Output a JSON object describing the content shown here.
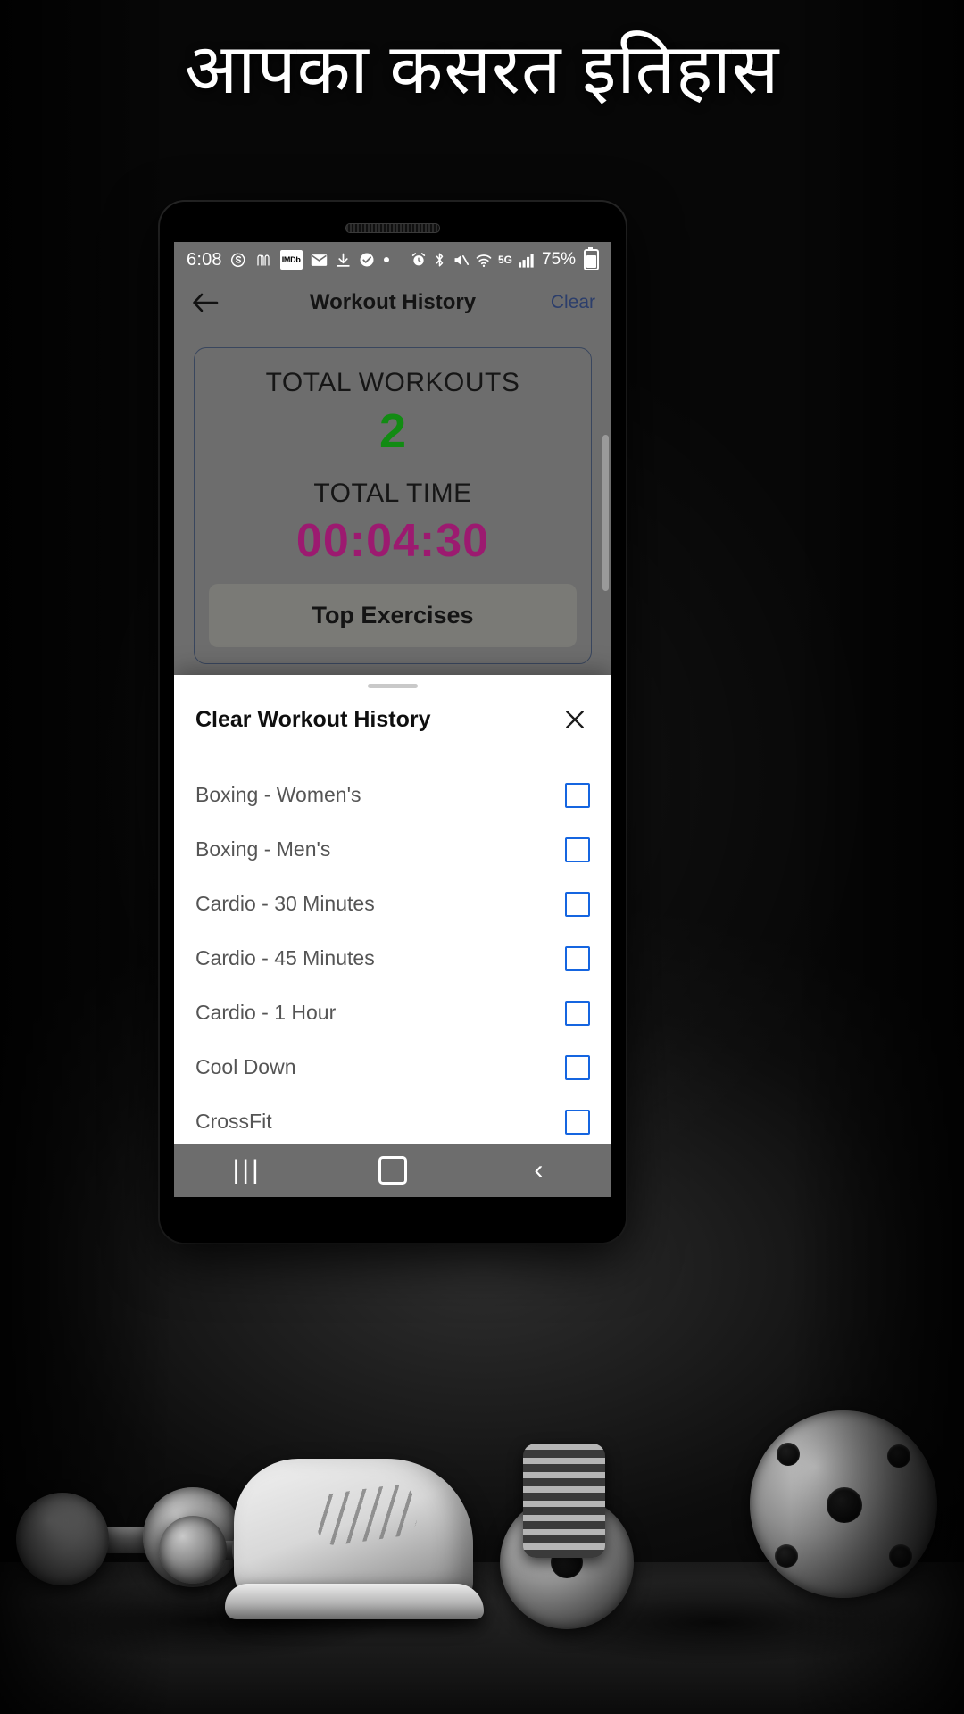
{
  "headline": "आपका कसरत इतिहास",
  "phone": {
    "status_bar": {
      "time": "6:08",
      "left_icons": [
        "skype-icon",
        "mcdonalds-icon",
        "imdb-icon",
        "mail-icon",
        "download-icon",
        "check-circle-icon",
        "dot-icon"
      ],
      "imdb_label": "IMDb",
      "right_icons": [
        "alarm-icon",
        "bluetooth-icon",
        "mute-icon",
        "wifi-icon",
        "5g-icon",
        "signal-icon"
      ],
      "network_label": "5G",
      "battery_percent": "75%"
    },
    "app_bar": {
      "back_icon": "back-arrow-icon",
      "title": "Workout History",
      "action_label": "Clear",
      "action_color": "#2c3e6b"
    },
    "stats": {
      "workouts_label": "TOTAL WORKOUTS",
      "workouts_value": "2",
      "workouts_color": "#128b13",
      "time_label": "TOTAL TIME",
      "time_value": "00:04:30",
      "time_color": "#9c1a70",
      "top_exercises_label": "Top Exercises"
    },
    "sheet": {
      "title": "Clear Workout History",
      "close_icon": "close-icon",
      "items": [
        {
          "label": "Boxing - Women's",
          "checked": false
        },
        {
          "label": "Boxing - Men's",
          "checked": false
        },
        {
          "label": "Cardio - 30 Minutes",
          "checked": false
        },
        {
          "label": "Cardio - 45 Minutes",
          "checked": false
        },
        {
          "label": "Cardio - 1 Hour",
          "checked": false
        },
        {
          "label": "Cool Down",
          "checked": false
        },
        {
          "label": "CrossFit",
          "checked": false
        }
      ],
      "checkbox_color": "#1565e0"
    },
    "nav_bar": {
      "recents_label": "|||",
      "home_icon": "home-square-icon",
      "back_label": "‹"
    }
  }
}
